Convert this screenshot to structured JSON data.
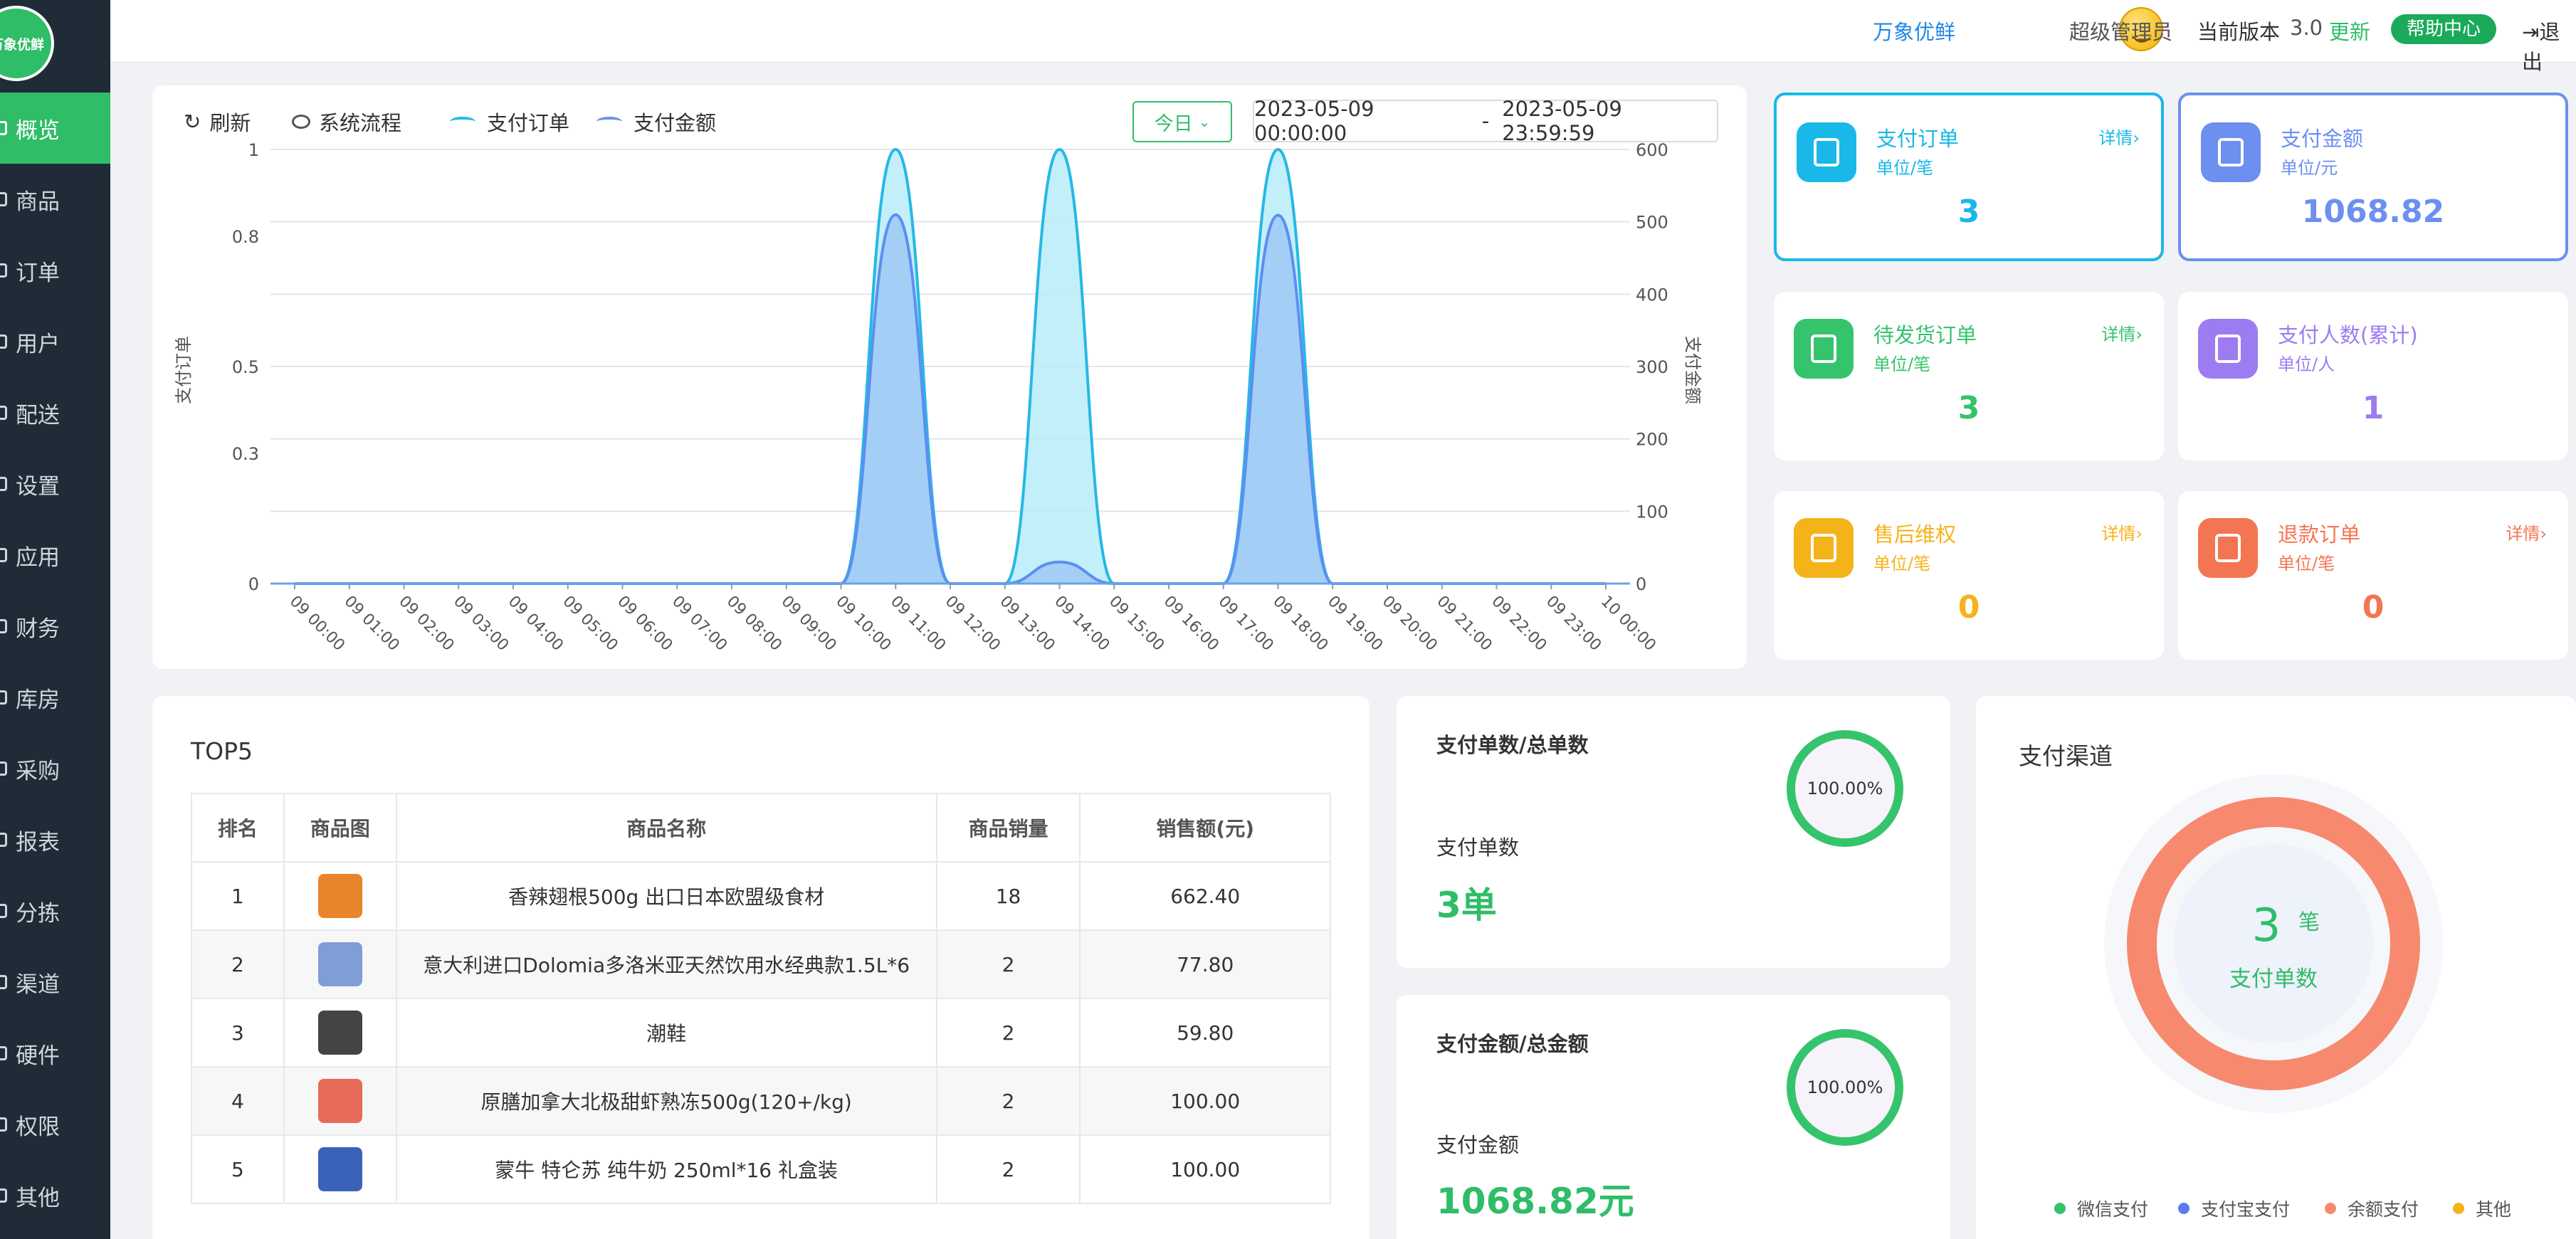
{
  "sidebar": {
    "logo_text": "万象优鲜",
    "items": [
      {
        "label": "概览",
        "active": true
      },
      {
        "label": "商品"
      },
      {
        "label": "订单"
      },
      {
        "label": "用户"
      },
      {
        "label": "配送"
      },
      {
        "label": "设置"
      },
      {
        "label": "应用"
      },
      {
        "label": "财务"
      },
      {
        "label": "库房"
      },
      {
        "label": "采购"
      },
      {
        "label": "报表"
      },
      {
        "label": "分拣"
      },
      {
        "label": "渠道"
      },
      {
        "label": "硬件"
      },
      {
        "label": "权限"
      },
      {
        "label": "其他"
      }
    ]
  },
  "header": {
    "brand": "万象优鲜",
    "user": "超级管理员",
    "version_label": "当前版本",
    "version": "3.0",
    "update": "更新",
    "help": "帮助中心",
    "logout": "退出"
  },
  "chart_toolbar": {
    "refresh": "刷新",
    "flow": "系统流程",
    "today": "今日",
    "date_start": "2023-05-09 00:00:00",
    "date_sep": "-",
    "date_end": "2023-05-09 23:59:59"
  },
  "chart_data": {
    "type": "area",
    "legend": [
      "支付订单",
      "支付金额"
    ],
    "ylabel": "支付订单",
    "y2label": "支付金额",
    "y_ticks": [
      "1",
      "0.8",
      "0.5",
      "0.3",
      "0"
    ],
    "y2_ticks": [
      "600",
      "500",
      "400",
      "300",
      "200",
      "100",
      "0"
    ],
    "ylim": [
      0,
      1
    ],
    "y2lim": [
      0,
      600
    ],
    "categories": [
      "09 00:00",
      "09 01:00",
      "09 02:00",
      "09 03:00",
      "09 04:00",
      "09 05:00",
      "09 06:00",
      "09 07:00",
      "09 08:00",
      "09 09:00",
      "09 10:00",
      "09 11:00",
      "09 12:00",
      "09 13:00",
      "09 14:00",
      "09 15:00",
      "09 16:00",
      "09 17:00",
      "09 18:00",
      "09 19:00",
      "09 20:00",
      "09 21:00",
      "09 22:00",
      "09 23:00",
      "10 00:00"
    ],
    "series": [
      {
        "name": "支付订单",
        "axis": "left",
        "color": "#27b8e5",
        "fill": "#b8ecfa",
        "values": [
          0,
          0,
          0,
          0,
          0,
          0,
          0,
          0,
          0,
          0,
          0,
          1,
          0,
          0,
          1,
          0,
          0,
          0,
          1,
          0,
          0,
          0,
          0,
          0,
          0
        ]
      },
      {
        "name": "支付金额",
        "axis": "right",
        "color": "#5b8ff0",
        "fill": "#9ec9f5",
        "values": [
          0,
          0,
          0,
          0,
          0,
          0,
          0,
          0,
          0,
          0,
          0,
          509.8,
          0,
          0,
          29.8,
          0,
          0,
          0,
          509.2,
          0,
          0,
          0,
          0,
          0,
          0
        ]
      }
    ]
  },
  "stats": [
    {
      "title": "支付订单",
      "unit": "单位/笔",
      "link": "详情",
      "value": "3",
      "color": "#19b8e8"
    },
    {
      "title": "支付金额",
      "unit": "单位/元",
      "link": "",
      "value": "1068.82",
      "color": "#6c8ff0"
    },
    {
      "title": "待发货订单",
      "unit": "单位/笔",
      "link": "详情",
      "value": "3",
      "color": "#35c46c"
    },
    {
      "title": "支付人数(累计)",
      "unit": "单位/人",
      "link": "",
      "value": "1",
      "color": "#9c7cf0"
    },
    {
      "title": "售后维权",
      "unit": "单位/笔",
      "link": "详情",
      "value": "0",
      "color": "#f5b31a"
    },
    {
      "title": "退款订单",
      "unit": "单位/笔",
      "link": "详情",
      "value": "0",
      "color": "#f47552"
    }
  ],
  "top5": {
    "title": "TOP5",
    "headers": [
      "排名",
      "商品图",
      "商品名称",
      "商品销量",
      "销售额(元)"
    ],
    "rows": [
      {
        "rank": "1",
        "name": "香辣翅根500g 出口日本欧盟级食材",
        "qty": "18",
        "amount": "662.40",
        "img_color": "#e8842a"
      },
      {
        "rank": "2",
        "name": "意大利进口Dolomia多洛米亚天然饮用水经典款1.5L*6",
        "qty": "2",
        "amount": "77.80",
        "img_color": "#7f9ed8"
      },
      {
        "rank": "3",
        "name": "潮鞋",
        "qty": "2",
        "amount": "59.80",
        "img_color": "#444444"
      },
      {
        "rank": "4",
        "name": "原膳加拿大北极甜虾熟冻500g(120+/kg)",
        "qty": "2",
        "amount": "100.00",
        "img_color": "#e86a5a"
      },
      {
        "rank": "5",
        "name": "蒙牛 特仑苏 纯牛奶 250ml*16 礼盒装",
        "qty": "2",
        "amount": "100.00",
        "img_color": "#3a62b8"
      }
    ]
  },
  "ratio1": {
    "title": "支付单数/总单数",
    "percent": "100.00%",
    "label": "支付单数",
    "value": "3单"
  },
  "ratio2": {
    "title": "支付金额/总金额",
    "percent": "100.00%",
    "label": "支付金额",
    "value": "1068.82元"
  },
  "channels": {
    "title": "支付渠道",
    "count": "3",
    "count_unit": "笔",
    "center_label": "支付单数",
    "legend": [
      {
        "name": "微信支付",
        "color": "#35c46c"
      },
      {
        "name": "支付宝支付",
        "color": "#5b7cf0"
      },
      {
        "name": "余额支付",
        "color": "#f7896f"
      },
      {
        "name": "其他",
        "color": "#f5b31a"
      }
    ],
    "values": [
      0,
      0,
      3,
      0
    ]
  }
}
